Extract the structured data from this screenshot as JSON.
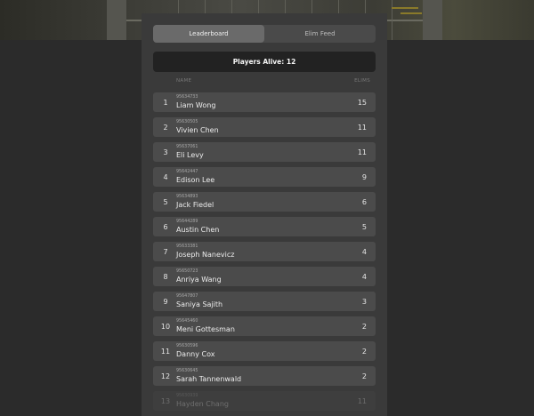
{
  "tabs": {
    "leaderboard": "Leaderboard",
    "elim_feed": "Elim Feed"
  },
  "players_alive": "Players Alive: 12",
  "columns": {
    "name": "NAME",
    "elims": "ELIMS"
  },
  "rows": [
    {
      "rank": "1",
      "id": "95634733",
      "name": "Liam Wong",
      "elims": "15"
    },
    {
      "rank": "2",
      "id": "95630505",
      "name": "Vivien Chen",
      "elims": "11"
    },
    {
      "rank": "3",
      "id": "95637061",
      "name": "Eli Levy",
      "elims": "11"
    },
    {
      "rank": "4",
      "id": "95642447",
      "name": "Edison Lee",
      "elims": "9"
    },
    {
      "rank": "5",
      "id": "95634893",
      "name": "Jack Fiedel",
      "elims": "6"
    },
    {
      "rank": "6",
      "id": "95644289",
      "name": "Austin Chen",
      "elims": "5"
    },
    {
      "rank": "7",
      "id": "95633381",
      "name": "Joseph Nanevicz",
      "elims": "4"
    },
    {
      "rank": "8",
      "id": "95650723",
      "name": "Anriya Wang",
      "elims": "4"
    },
    {
      "rank": "9",
      "id": "95647807",
      "name": "Saniya Sajith",
      "elims": "3"
    },
    {
      "rank": "10",
      "id": "95645460",
      "name": "Meni Gottesman",
      "elims": "2"
    },
    {
      "rank": "11",
      "id": "95630596",
      "name": "Danny Cox",
      "elims": "2"
    },
    {
      "rank": "12",
      "id": "95630645",
      "name": "Sarah Tannenwald",
      "elims": "2"
    },
    {
      "rank": "13",
      "id": "95630939",
      "name": "Hayden Chang",
      "elims": "11"
    }
  ]
}
